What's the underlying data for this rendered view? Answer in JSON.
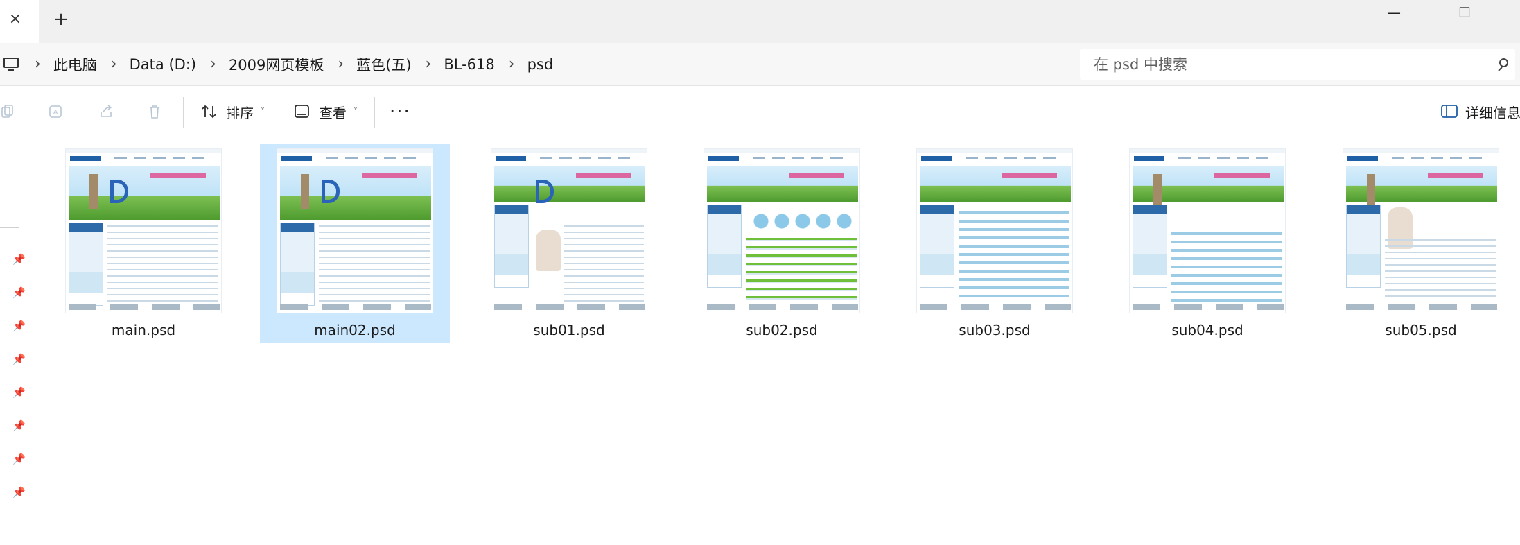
{
  "tabbar": {
    "close_glyph": "×",
    "new_tab_glyph": "+",
    "minimize_glyph": "—",
    "maximize_glyph": "☐",
    "close_window_glyph": "×"
  },
  "address": {
    "root_icon": "this-pc-icon",
    "crumbs": [
      "此电脑",
      "Data (D:)",
      "2009网页模板",
      "蓝色(五)",
      "BL-618",
      "psd"
    ],
    "separator": "›"
  },
  "search": {
    "placeholder": "在 psd 中搜索",
    "icon": "search-icon"
  },
  "commandbar": {
    "sort_label": "排序",
    "view_label": "查看",
    "more_label": "···",
    "details_label": "详细信息",
    "chevron": "˅"
  },
  "files": [
    {
      "name": "main.psd",
      "selected": false
    },
    {
      "name": "main02.psd",
      "selected": true
    },
    {
      "name": "sub01.psd",
      "selected": false
    },
    {
      "name": "sub02.psd",
      "selected": false
    },
    {
      "name": "sub03.psd",
      "selected": false
    },
    {
      "name": "sub04.psd",
      "selected": false
    },
    {
      "name": "sub05.psd",
      "selected": false
    }
  ],
  "colors": {
    "selection": "#cce8ff",
    "title_bar": "#f0f0f0",
    "address_bar": "#f7f7f7"
  }
}
